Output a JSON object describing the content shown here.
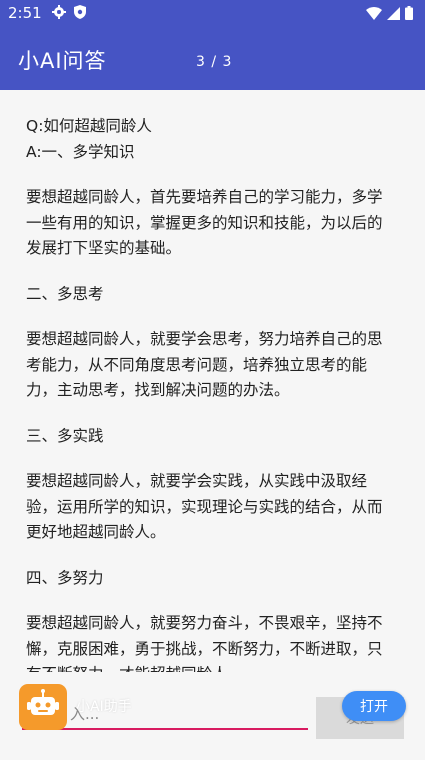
{
  "status_bar": {
    "time": "2:51",
    "icons": [
      "gear-icon",
      "shield-icon",
      "wifi-icon",
      "signal-icon",
      "battery-icon"
    ]
  },
  "app_bar": {
    "title": "小AI问答",
    "page_counter": "3 / 3"
  },
  "content": {
    "question": "Q:如何超越同龄人",
    "answer_first_line": "A:一、多学知识",
    "paragraphs": [
      "要想超越同龄人，首先要培养自己的学习能力，多学一些有用的知识，掌握更多的知识和技能，为以后的发展打下坚实的基础。",
      "二、多思考",
      "要想超越同龄人，就要学会思考，努力培养自己的思考能力，从不同角度思考问题，培养独立思考的能力，主动思考，找到解决问题的办法。",
      "三、多实践",
      "要想超越同龄人，就要学会实践，从实践中汲取经验，运用所学的知识，实现理论与实践的结合，从而更好地超越同龄人。",
      "四、多努力",
      "要想超越同龄人，就要努力奋斗，不畏艰辛，坚持不懈，克服困难，勇于挑战，不断努力，不断进取，只有不断努力，才能超越同龄人。"
    ]
  },
  "bottom": {
    "input_placeholder": "入...",
    "send_label": "发送",
    "ad_label": "小AI助手",
    "open_label": "打开"
  },
  "colors": {
    "primary": "#4654c4",
    "accent_underline": "#d81b60",
    "robot_badge": "#f59a2b",
    "open_button": "#3f8ef6"
  }
}
